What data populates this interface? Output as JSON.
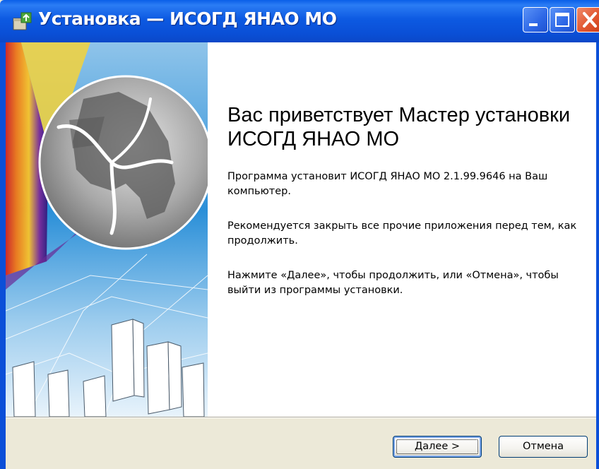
{
  "window": {
    "title": "Установка — ИСОГД ЯНАО МО",
    "icon": "installer-package-icon",
    "controls": [
      "minimize-icon",
      "maximize-icon",
      "close-icon"
    ]
  },
  "welcome": {
    "title": "Вас приветствует Мастер установки ИСОГД ЯНАО МО",
    "paragraphs": [
      "Программа установит ИСОГД ЯНАО МО 2.1.99.9646 на Ваш компьютер.",
      "Рекомендуется закрыть все прочие приложения перед тем, как продолжить.",
      "Нажмите «Далее», чтобы продолжить, или «Отмена», чтобы выйти из программы установки."
    ]
  },
  "buttons": {
    "next_accel": "Д",
    "next_rest": "алее >",
    "cancel": "Отмена"
  },
  "colors": {
    "titlebar": "#0a5fe8",
    "face": "#ece9d8",
    "close": "#e0552f"
  }
}
